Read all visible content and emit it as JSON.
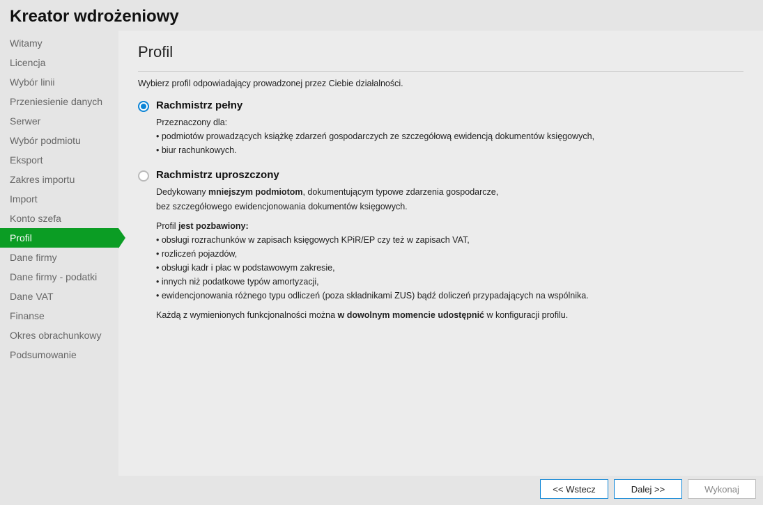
{
  "header": {
    "title": "Kreator wdrożeniowy"
  },
  "sidebar": {
    "items": [
      {
        "label": "Witamy"
      },
      {
        "label": "Licencja"
      },
      {
        "label": "Wybór linii"
      },
      {
        "label": "Przeniesienie danych"
      },
      {
        "label": "Serwer"
      },
      {
        "label": "Wybór podmiotu"
      },
      {
        "label": "Eksport"
      },
      {
        "label": "Zakres importu"
      },
      {
        "label": "Import"
      },
      {
        "label": "Konto szefa"
      },
      {
        "label": "Profil",
        "active": true
      },
      {
        "label": "Dane firmy"
      },
      {
        "label": "Dane firmy - podatki"
      },
      {
        "label": "Dane VAT"
      },
      {
        "label": "Finanse"
      },
      {
        "label": "Okres obrachunkowy"
      },
      {
        "label": "Podsumowanie"
      }
    ]
  },
  "page": {
    "title": "Profil",
    "instruction": "Wybierz profil odpowiadający prowadzonej przez Ciebie działalności.",
    "option1": {
      "label": "Rachmistrz pełny",
      "intro": "Przeznaczony dla:",
      "bullet1": "• podmiotów prowadzących książkę zdarzeń gospodarczych ze szczegółową ewidencją dokumentów księgowych,",
      "bullet2": "• biur rachunkowych."
    },
    "option2": {
      "label": "Rachmistrz uproszczony",
      "line1a": "Dedykowany ",
      "line1b": "mniejszym podmiotom",
      "line1c": ", dokumentującym typowe zdarzenia gospodarcze,",
      "line2": "bez szczegółowego ewidencjonowania dokumentów księgowych.",
      "intro2a": "Profil ",
      "intro2b": "jest pozbawiony:",
      "b1": "• obsługi rozrachunków w zapisach księgowych KPiR/EP czy też w zapisach VAT,",
      "b2": "• rozliczeń pojazdów,",
      "b3": "• obsługi kadr i płac w podstawowym zakresie,",
      "b4": "• innych niż podatkowe typów amortyzacji,",
      "b5": "• ewidencjonowania różnego typu odliczeń (poza składnikami ZUS) bądź doliczeń przypadających na wspólnika.",
      "footnote_a": "Każdą z wymienionych funkcjonalności można ",
      "footnote_b": "w dowolnym momencie udostępnić",
      "footnote_c": " w konfiguracji profilu."
    }
  },
  "footer": {
    "back": "<< Wstecz",
    "next": "Dalej >>",
    "exec": "Wykonaj"
  }
}
